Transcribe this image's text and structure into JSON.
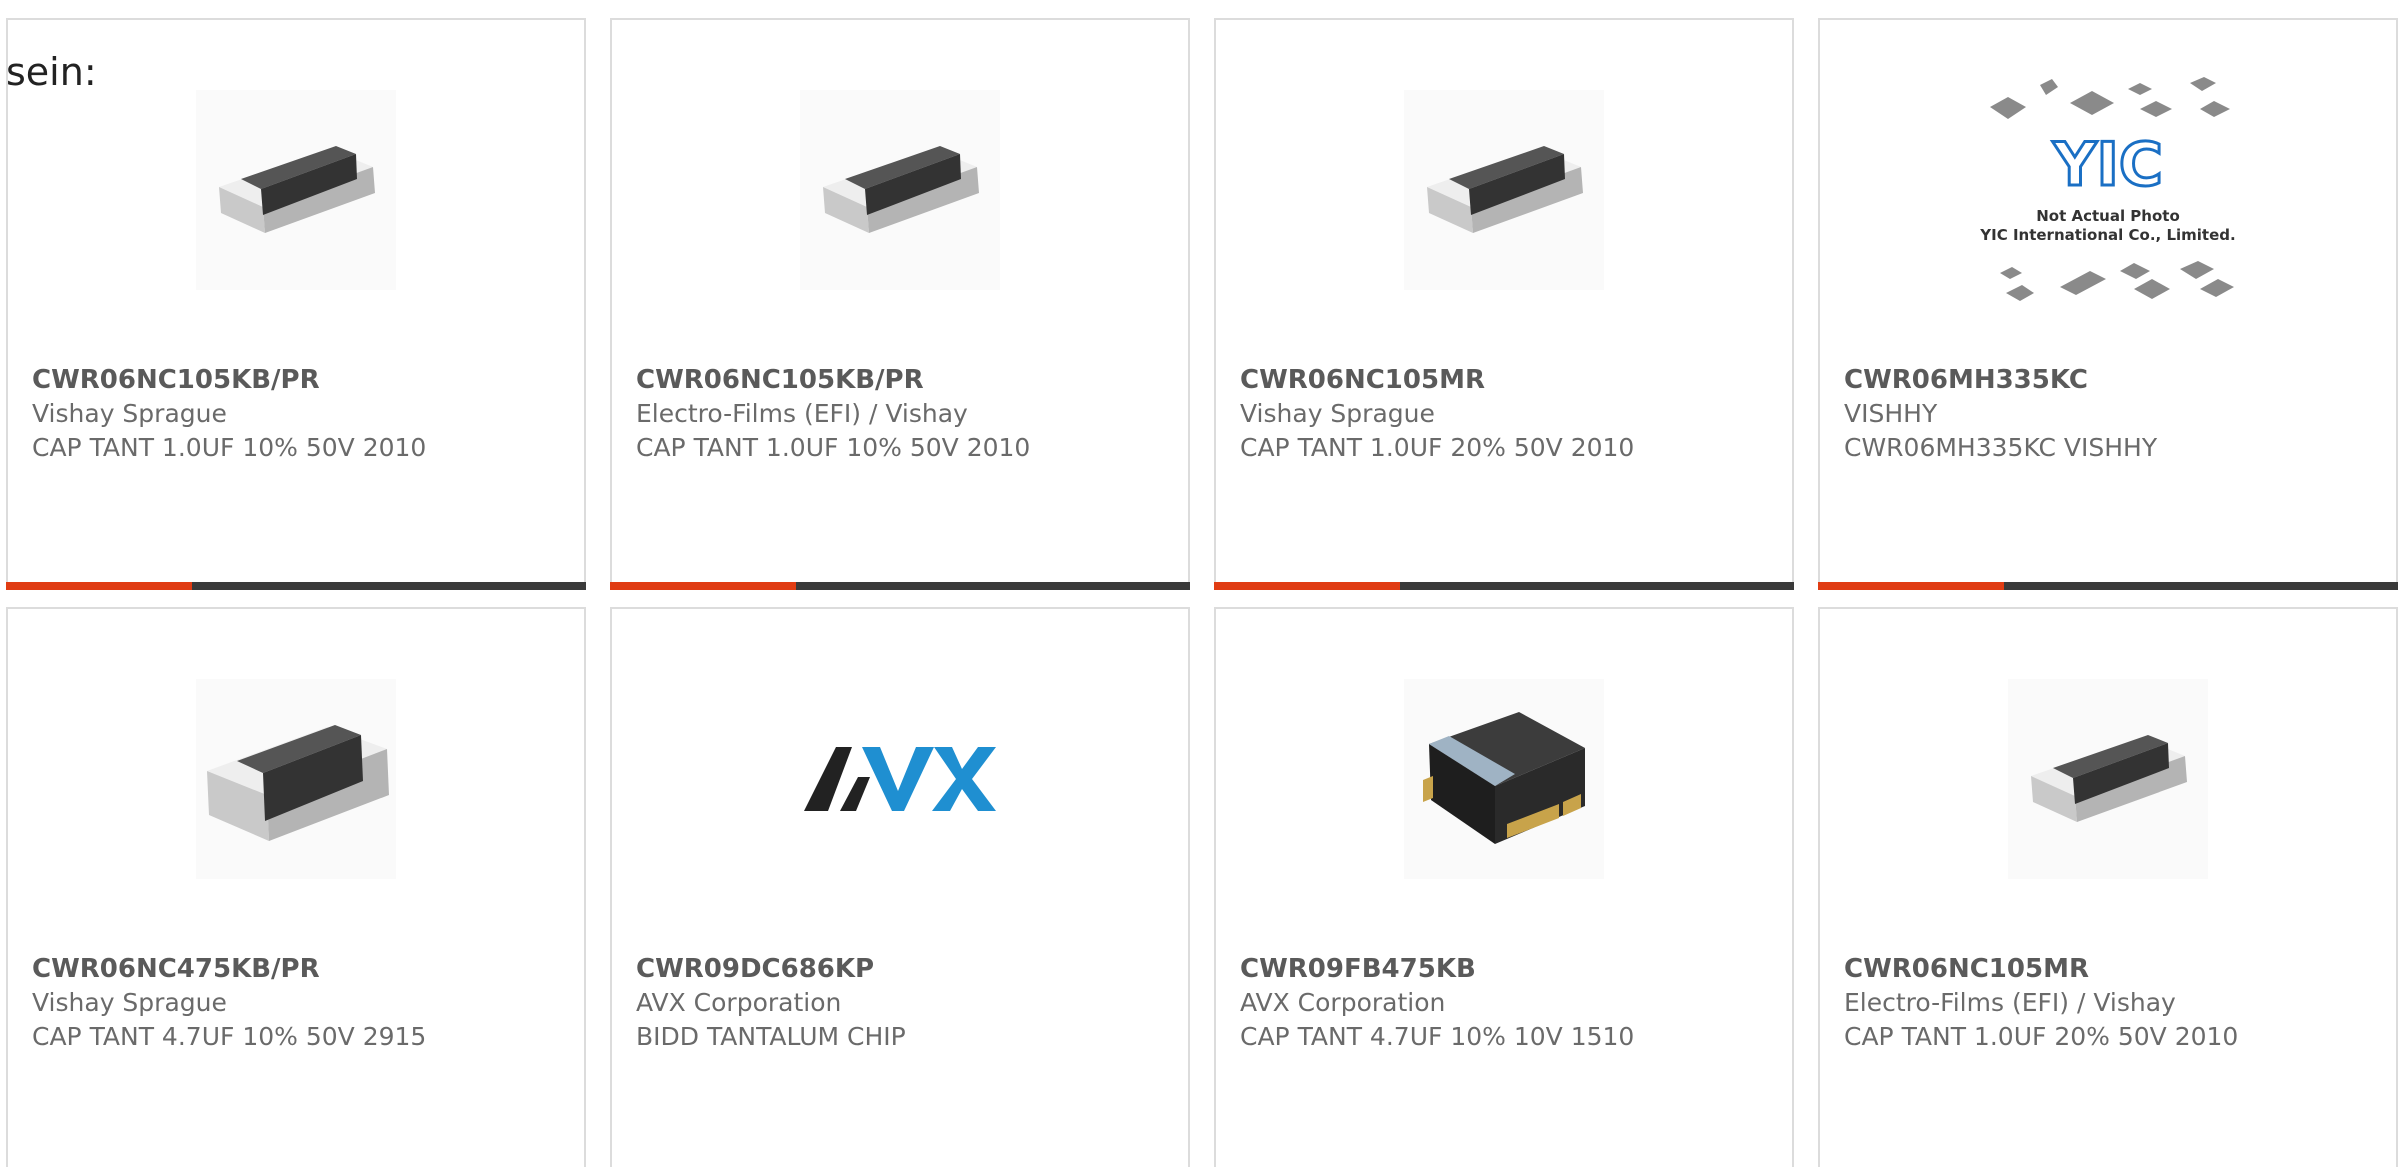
{
  "overlay_text": "sein:",
  "cards": [
    {
      "part": "CWR06NC105KB/PR",
      "manufacturer": "Vishay Sprague",
      "description": "CAP TANT 1.0UF 10% 50V 2010",
      "image_icon": "chip-capacitor-icon",
      "progress": 0.32
    },
    {
      "part": "CWR06NC105KB/PR",
      "manufacturer": "Electro-Films (EFI) / Vishay",
      "description": "CAP TANT 1.0UF 10% 50V 2010",
      "image_icon": "chip-capacitor-icon",
      "progress": 0.32
    },
    {
      "part": "CWR06NC105MR",
      "manufacturer": "Vishay Sprague",
      "description": "CAP TANT 1.0UF 20% 50V 2010",
      "image_icon": "chip-capacitor-icon",
      "progress": 0.32
    },
    {
      "part": "CWR06MH335KC",
      "manufacturer": "VISHHY",
      "description": "CWR06MH335KC VISHHY",
      "image_icon": "yic-placeholder-icon",
      "image_caption_1": "Not Actual Photo",
      "image_caption_2": "YIC International Co., Limited.",
      "image_logo": "YIC",
      "progress": 0.32
    },
    {
      "part": "CWR06NC475KB/PR",
      "manufacturer": "Vishay Sprague",
      "description": "CAP TANT 4.7UF 10% 50V 2915",
      "image_icon": "chip-capacitor-icon"
    },
    {
      "part": "CWR09DC686KP",
      "manufacturer": "AVX Corporation",
      "description": "BIDD TANTALUM CHIP",
      "image_icon": "avx-logo-icon",
      "image_logo": "AVX"
    },
    {
      "part": "CWR09FB475KB",
      "manufacturer": "AVX Corporation",
      "description": "CAP TANT 4.7UF 10% 10V 1510",
      "image_icon": "molded-tantalum-icon"
    },
    {
      "part": "CWR06NC105MR",
      "manufacturer": "Electro-Films (EFI) / Vishay",
      "description": "CAP TANT 1.0UF 20% 50V 2010",
      "image_icon": "chip-capacitor-icon"
    }
  ],
  "colors": {
    "progress_accent": "#e03c13",
    "progress_track": "#3a3a3a",
    "avx_blue": "#1f8fd1",
    "yic_blue": "#1a6fc4"
  }
}
